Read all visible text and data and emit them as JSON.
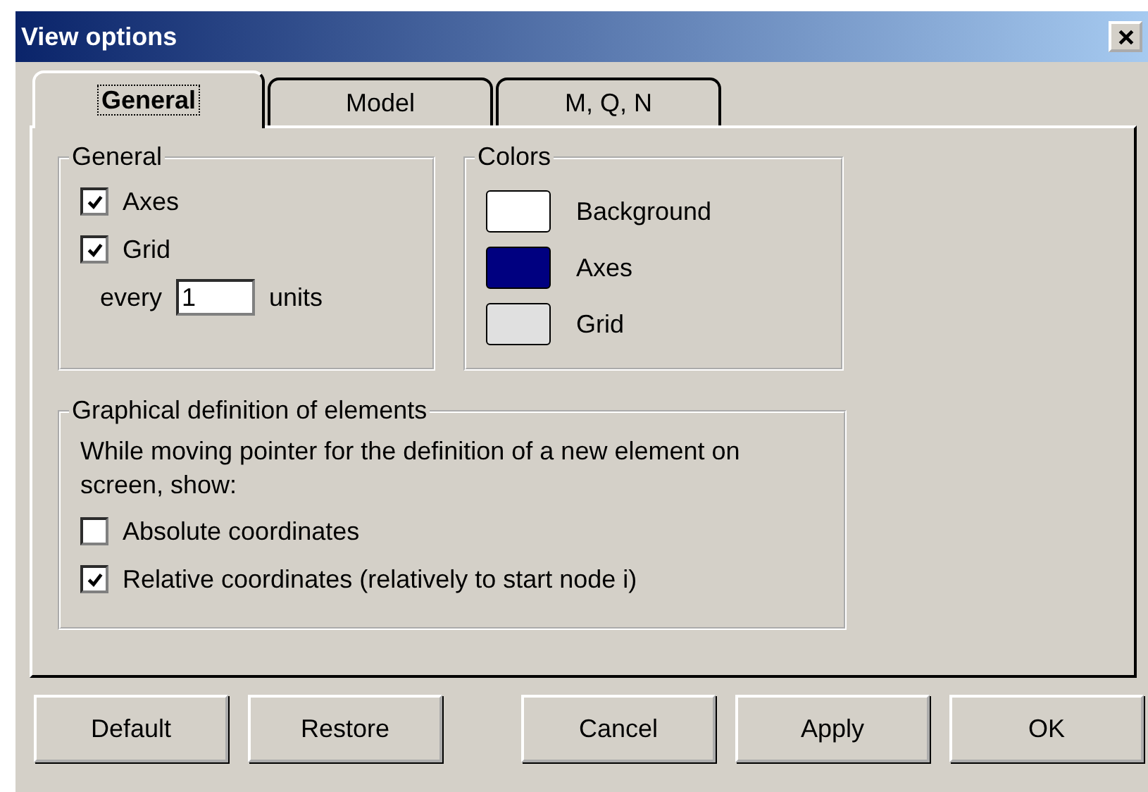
{
  "window": {
    "title": "View options"
  },
  "tabs": [
    {
      "label": "General",
      "selected": true
    },
    {
      "label": "Model",
      "selected": false
    },
    {
      "label": "M, Q, N",
      "selected": false
    }
  ],
  "general": {
    "title": "General",
    "checkboxes": [
      {
        "label": "Axes",
        "checked": true
      },
      {
        "label": "Grid",
        "checked": true
      }
    ],
    "grid_spacing": {
      "prefix": "every",
      "value": "1",
      "suffix": "units"
    }
  },
  "colors": {
    "title": "Colors",
    "items": [
      {
        "label": "Background",
        "color": "#ffffff"
      },
      {
        "label": "Axes",
        "color": "#000080"
      },
      {
        "label": "Grid",
        "color": "#e0e0e0"
      }
    ]
  },
  "graphical_definition": {
    "title": "Graphical definition of elements",
    "description": "While moving pointer for the definition of a new element on screen, show:",
    "options": [
      {
        "label": "Absolute coordinates",
        "checked": false
      },
      {
        "label": "Relative coordinates (relatively to start node i)",
        "checked": true
      }
    ]
  },
  "buttons": [
    "Default",
    "Restore",
    "Cancel",
    "Apply",
    "OK"
  ]
}
